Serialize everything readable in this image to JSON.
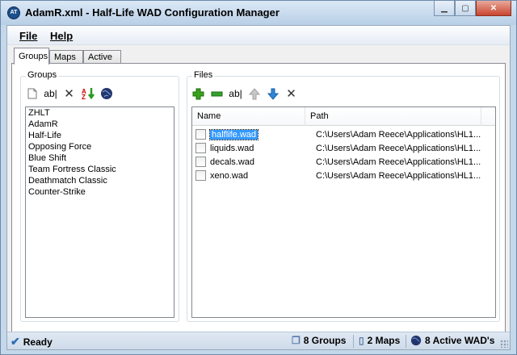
{
  "window": {
    "title": "AdamR.xml - Half-Life WAD Configuration Manager",
    "app_icon": "AT"
  },
  "menu": [
    {
      "label": "File"
    },
    {
      "label": "Help"
    }
  ],
  "tabs": [
    {
      "label": "Groups",
      "active": true
    },
    {
      "label": "Maps",
      "active": false
    },
    {
      "label": "Active",
      "active": false
    }
  ],
  "groups_panel": {
    "label": "Groups",
    "toolbar": [
      "new-document-icon",
      "rename-icon",
      "delete-icon",
      "sort-icon",
      "globe-icon"
    ],
    "items": [
      "ZHLT",
      "AdamR",
      "Half-Life",
      "Opposing Force",
      "Blue Shift",
      "Team Fortress Classic",
      "Deathmatch Classic",
      "Counter-Strike"
    ]
  },
  "files_panel": {
    "label": "Files",
    "toolbar": [
      "add-icon",
      "remove-icon",
      "rename-icon",
      "move-up-icon",
      "move-down-icon",
      "delete-icon"
    ],
    "columns": [
      "Name",
      "Path"
    ],
    "rows": [
      {
        "name": "halflife.wad",
        "path": "C:\\Users\\Adam Reece\\Applications\\HL1...",
        "selected": true,
        "checked": false
      },
      {
        "name": "liquids.wad",
        "path": "C:\\Users\\Adam Reece\\Applications\\HL1...",
        "selected": false,
        "checked": false
      },
      {
        "name": "decals.wad",
        "path": "C:\\Users\\Adam Reece\\Applications\\HL1...",
        "selected": false,
        "checked": false
      },
      {
        "name": "xeno.wad",
        "path": "C:\\Users\\Adam Reece\\Applications\\HL1...",
        "selected": false,
        "checked": false
      }
    ]
  },
  "status": {
    "ready": "Ready",
    "groups": "8 Groups",
    "maps": "2 Maps",
    "active": "8 Active WAD's"
  },
  "colors": {
    "selection": "#3399ff",
    "add_green": "#3aa21e",
    "remove_green": "#36a030",
    "arrow_blue": "#2f86d8"
  }
}
